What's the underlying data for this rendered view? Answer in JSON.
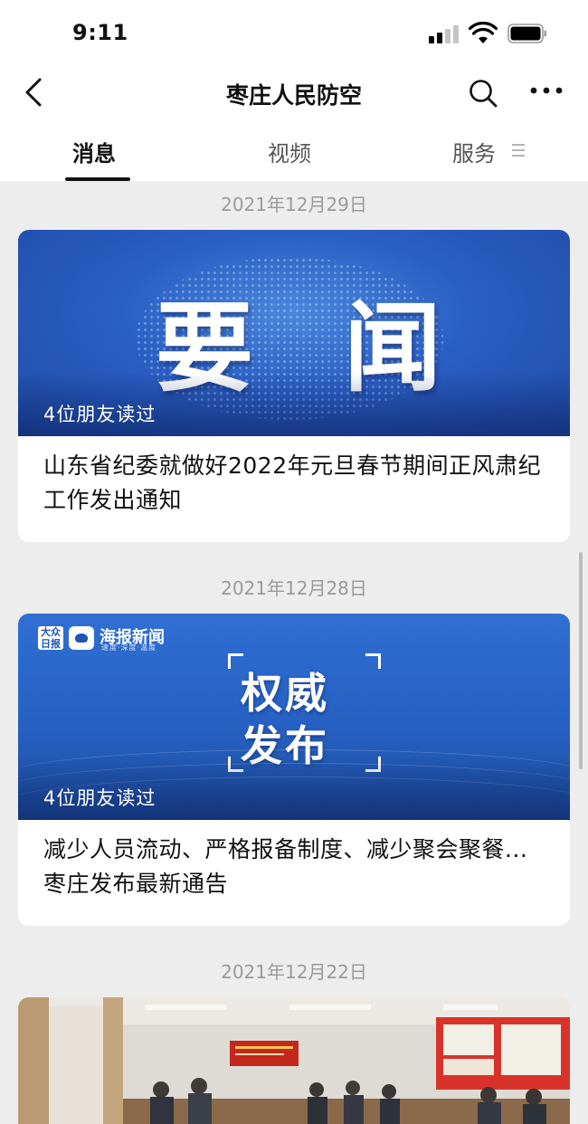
{
  "status_bar": {
    "time": "9:11"
  },
  "nav": {
    "title": "枣庄人民防空"
  },
  "tabs": [
    {
      "label": "消息",
      "active": true
    },
    {
      "label": "视频",
      "active": false
    },
    {
      "label": "服务",
      "active": false
    }
  ],
  "feed": [
    {
      "date": "2021年12月29日",
      "image_text": [
        "要",
        "闻"
      ],
      "read_count": "4位朋友读过",
      "title": "山东省纪委就做好2022年元旦春节期间正风肃纪工作发出通知"
    },
    {
      "date": "2021年12月28日",
      "image_logo": "海报新闻",
      "image_logo_sub": "速度·深度·温度",
      "image_logo_badge": "大众日报",
      "image_text": [
        "权威",
        "发布"
      ],
      "read_count": "4位朋友读过",
      "title": "减少人员流动、严格报备制度、减少聚会聚餐...枣庄发布最新通告"
    },
    {
      "date": "2021年12月22日"
    }
  ],
  "colors": {
    "accent_blue": "#2a5fc4",
    "background": "#ededed"
  }
}
